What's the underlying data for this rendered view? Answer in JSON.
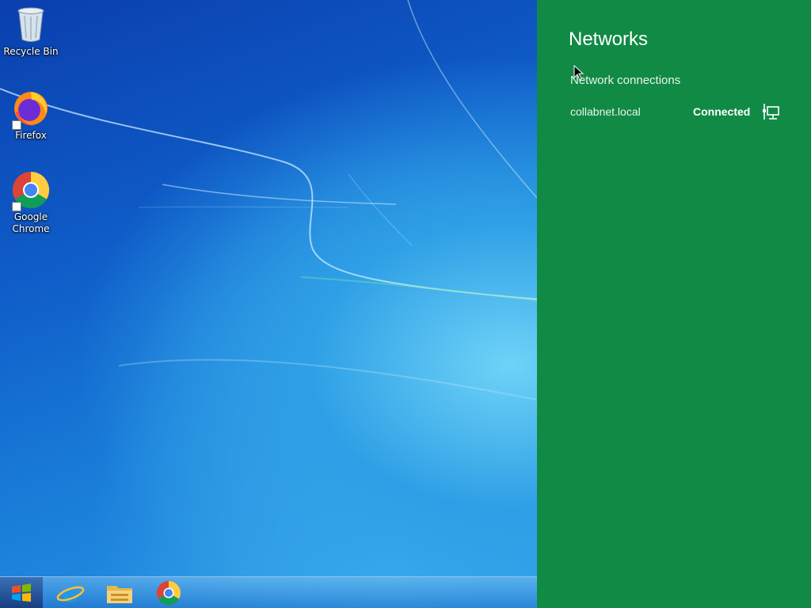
{
  "desktop": {
    "icons": [
      {
        "label": "Recycle Bin",
        "icon": "recycle-bin-icon"
      },
      {
        "label": "Firefox",
        "icon": "firefox-icon"
      },
      {
        "label": "Google Chrome",
        "icon": "chrome-icon"
      }
    ]
  },
  "taskbar": {
    "start_icon": "windows-logo-icon",
    "pinned": [
      {
        "app": "Internet Explorer",
        "icon": "internet-explorer-icon"
      },
      {
        "app": "File Explorer",
        "icon": "file-explorer-icon"
      },
      {
        "app": "Google Chrome",
        "icon": "chrome-icon"
      }
    ]
  },
  "networks_panel": {
    "title": "Networks",
    "section_heading": "Network connections",
    "connections": [
      {
        "name": "collabnet.local",
        "status": "Connected",
        "icon": "ethernet-icon"
      }
    ],
    "background_color": "#118a45"
  }
}
